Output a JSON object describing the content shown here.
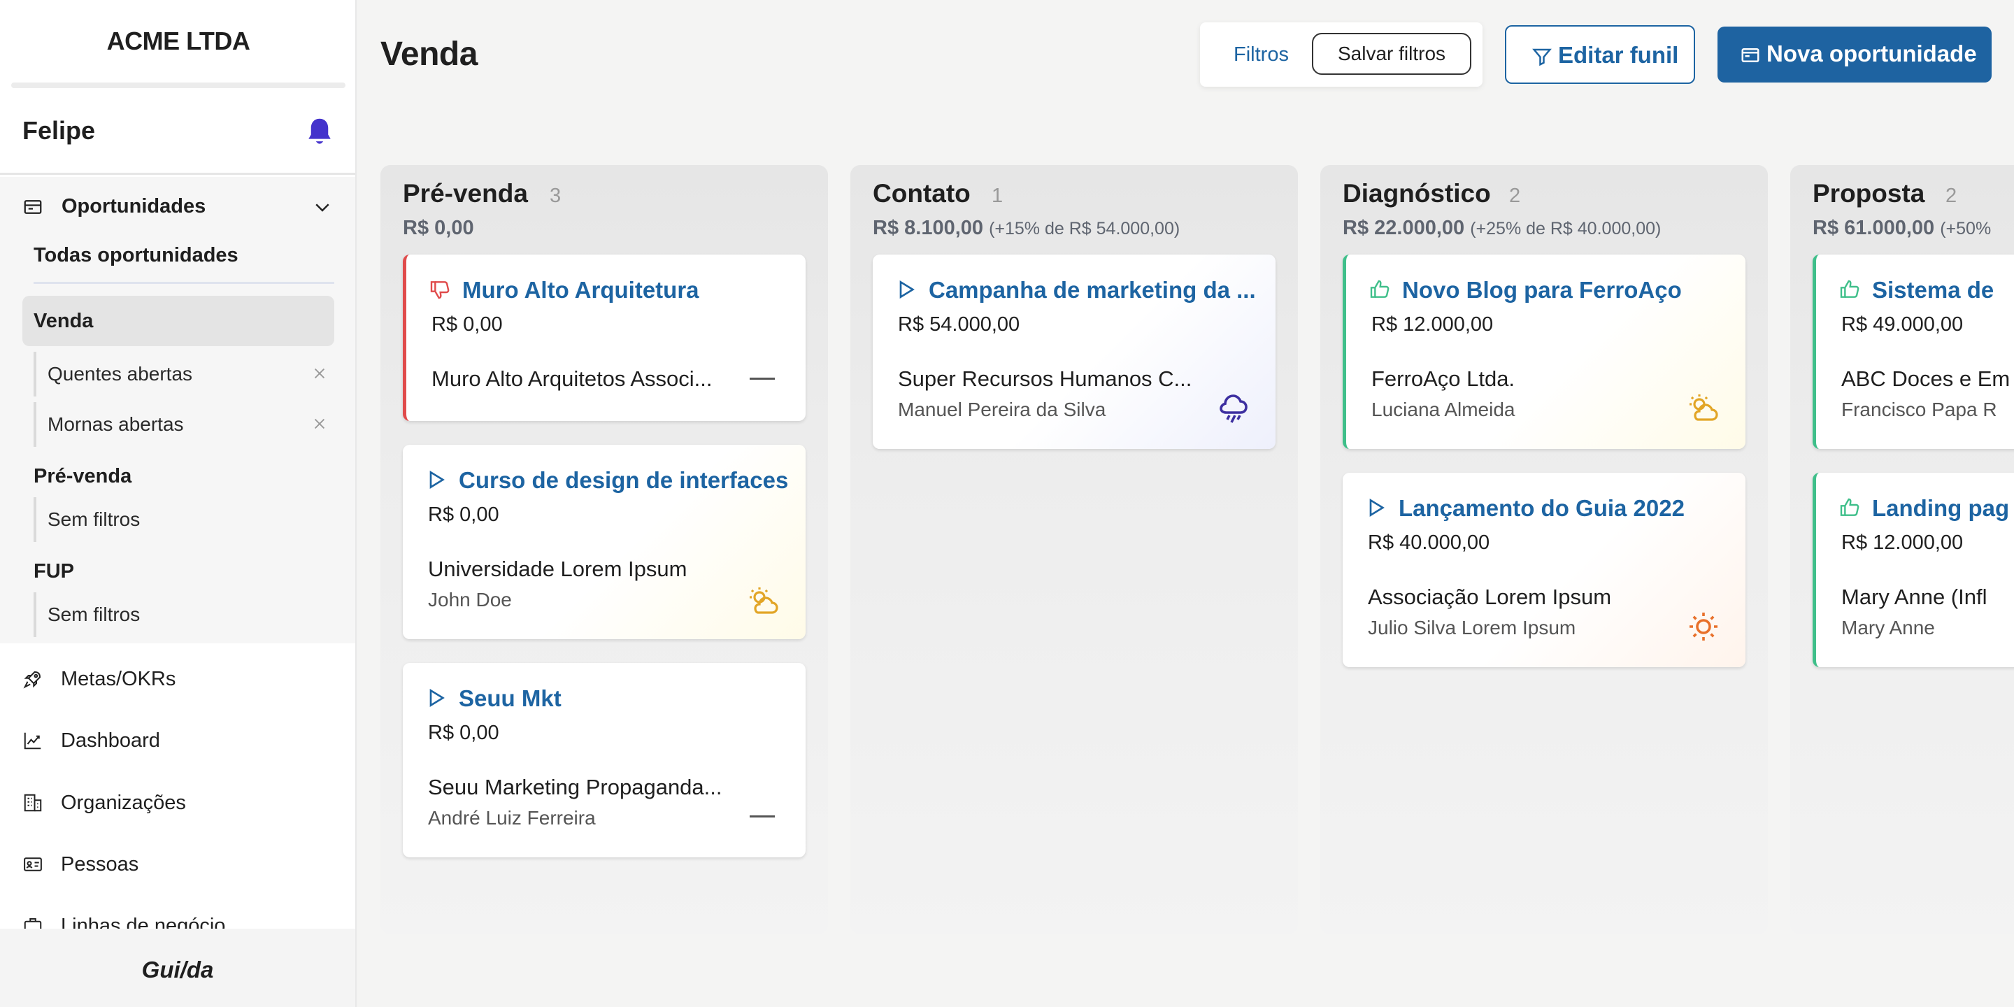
{
  "sidebar": {
    "company": "ACME LTDA",
    "user": "Felipe",
    "section": {
      "label": "Oportunidades",
      "all": "Todas oportunidades",
      "active_view": "Venda",
      "venda_filters": [
        "Quentes abertas",
        "Mornas abertas"
      ],
      "groups": [
        {
          "title": "Pré-venda",
          "item": "Sem filtros"
        },
        {
          "title": "FUP",
          "item": "Sem filtros"
        }
      ]
    },
    "nav": [
      "Metas/OKRs",
      "Dashboard",
      "Organizações",
      "Pessoas",
      "Linhas de negócio"
    ],
    "footer": "Gui/da"
  },
  "header": {
    "title": "Venda",
    "filters_label": "Filtros",
    "save_filters_label": "Salvar filtros",
    "edit_funnel_label": "Editar funil",
    "new_opportunity_label": "Nova oportunidade"
  },
  "colors": {
    "primary": "#1e63a1",
    "lost": "#e04b4b",
    "won": "#3fbf8a",
    "warm": "#e2a526",
    "hot": "#e8702a",
    "cold": "#3d2fa0",
    "bell": "#4433cc"
  },
  "columns": [
    {
      "name": "Pré-venda",
      "count": "3",
      "total": "R$ 0,00",
      "extra": "",
      "cards": [
        {
          "title": "Muro Alto Arquitetura",
          "value": "R$ 0,00",
          "org": "Muro Alto Arquitetos Associ...",
          "person": "",
          "status": "lost",
          "temp": "none"
        },
        {
          "title": "Curso de design de interfaces",
          "value": "R$ 0,00",
          "org": "Universidade Lorem Ipsum",
          "person": "John Doe",
          "status": "open",
          "temp": "warm"
        },
        {
          "title": "Seuu Mkt",
          "value": "R$ 0,00",
          "org": "Seuu Marketing Propaganda...",
          "person": "André Luiz Ferreira",
          "status": "open",
          "temp": "none"
        }
      ]
    },
    {
      "name": "Contato",
      "count": "1",
      "total": "R$ 8.100,00",
      "extra": "(+15% de R$ 54.000,00)",
      "cards": [
        {
          "title": "Campanha de marketing da ...",
          "value": "R$ 54.000,00",
          "org": "Super Recursos Humanos C...",
          "person": "Manuel Pereira da Silva",
          "status": "open",
          "temp": "cold"
        }
      ]
    },
    {
      "name": "Diagnóstico",
      "count": "2",
      "total": "R$ 22.000,00",
      "extra": "(+25% de R$ 40.000,00)",
      "cards": [
        {
          "title": "Novo Blog para FerroAço",
          "value": "R$ 12.000,00",
          "org": "FerroAço Ltda.",
          "person": "Luciana Almeida",
          "status": "won",
          "temp": "warm"
        },
        {
          "title": "Lançamento do Guia 2022",
          "value": "R$ 40.000,00",
          "org": "Associação Lorem Ipsum",
          "person": "Julio Silva Lorem Ipsum",
          "status": "open",
          "temp": "hot"
        }
      ]
    },
    {
      "name": "Proposta",
      "count": "2",
      "total": "R$ 61.000,00",
      "extra": "(+50%",
      "cards": [
        {
          "title": "Sistema de",
          "value": "R$ 49.000,00",
          "org": "ABC Doces e Em",
          "person": "Francisco Papa R",
          "status": "won",
          "temp": "none"
        },
        {
          "title": "Landing pag",
          "value": "R$ 12.000,00",
          "org": "Mary Anne (Infl",
          "person": "Mary Anne",
          "status": "won",
          "temp": "none"
        }
      ]
    }
  ]
}
